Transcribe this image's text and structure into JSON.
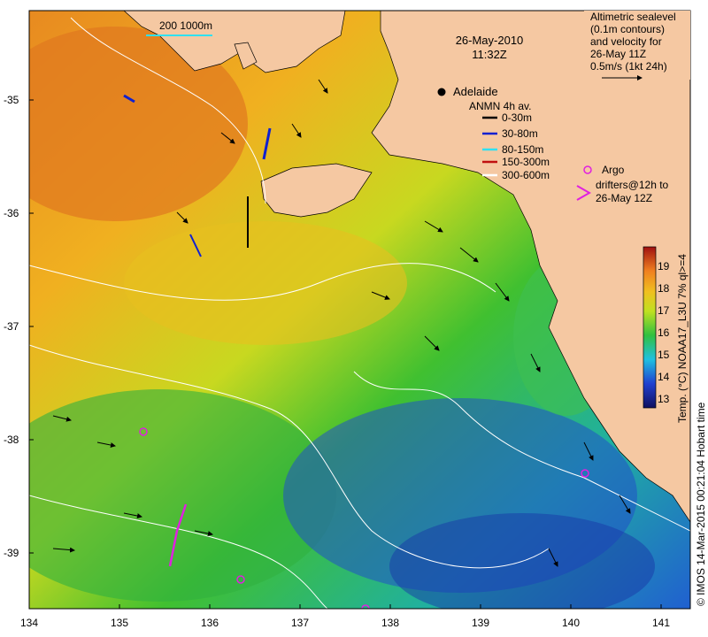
{
  "map": {
    "lon_range": [
      134,
      141.3
    ],
    "lat_range": [
      -39.5,
      -34.8
    ],
    "x_ticks": [
      "134",
      "135",
      "136",
      "137",
      "138",
      "139",
      "140",
      "141"
    ],
    "y_ticks": [
      "-35",
      "-36",
      "-37",
      "-38",
      "-39"
    ]
  },
  "title": {
    "date": "26-May-2010",
    "time": "11:32Z"
  },
  "scale_bar": "200  1000m",
  "places": {
    "adelaide": "Adelaide"
  },
  "altimetry_note": [
    "Altimetric sealevel",
    "(0.1m contours)",
    "and velocity for",
    "26-May 11Z",
    "0.5m/s (1kt 24h)"
  ],
  "anmn": {
    "title": "ANMN 4h av.",
    "items": [
      {
        "label": "0-30m",
        "color": "#000000"
      },
      {
        "label": "30-80m",
        "color": "#1020d0"
      },
      {
        "label": "80-150m",
        "color": "#30e0f0"
      },
      {
        "label": "150-300m",
        "color": "#c01010"
      },
      {
        "label": "300-600m",
        "color": "#ffffff"
      }
    ]
  },
  "argo": {
    "line1": "Argo",
    "line2": "drifters@12h to",
    "line3": "26-May 12Z",
    "color": "#e020e0"
  },
  "colorbar": {
    "ticks": [
      "19",
      "18",
      "17",
      "16",
      "15",
      "14",
      "13"
    ],
    "vmin": 12.5,
    "vmax": 19.8,
    "title": "Temp. (°C) NOAA17_L3U 7% ql>=4"
  },
  "credit": "© IMOS 14-Mar-2015 00:21:04 Hobart time"
}
